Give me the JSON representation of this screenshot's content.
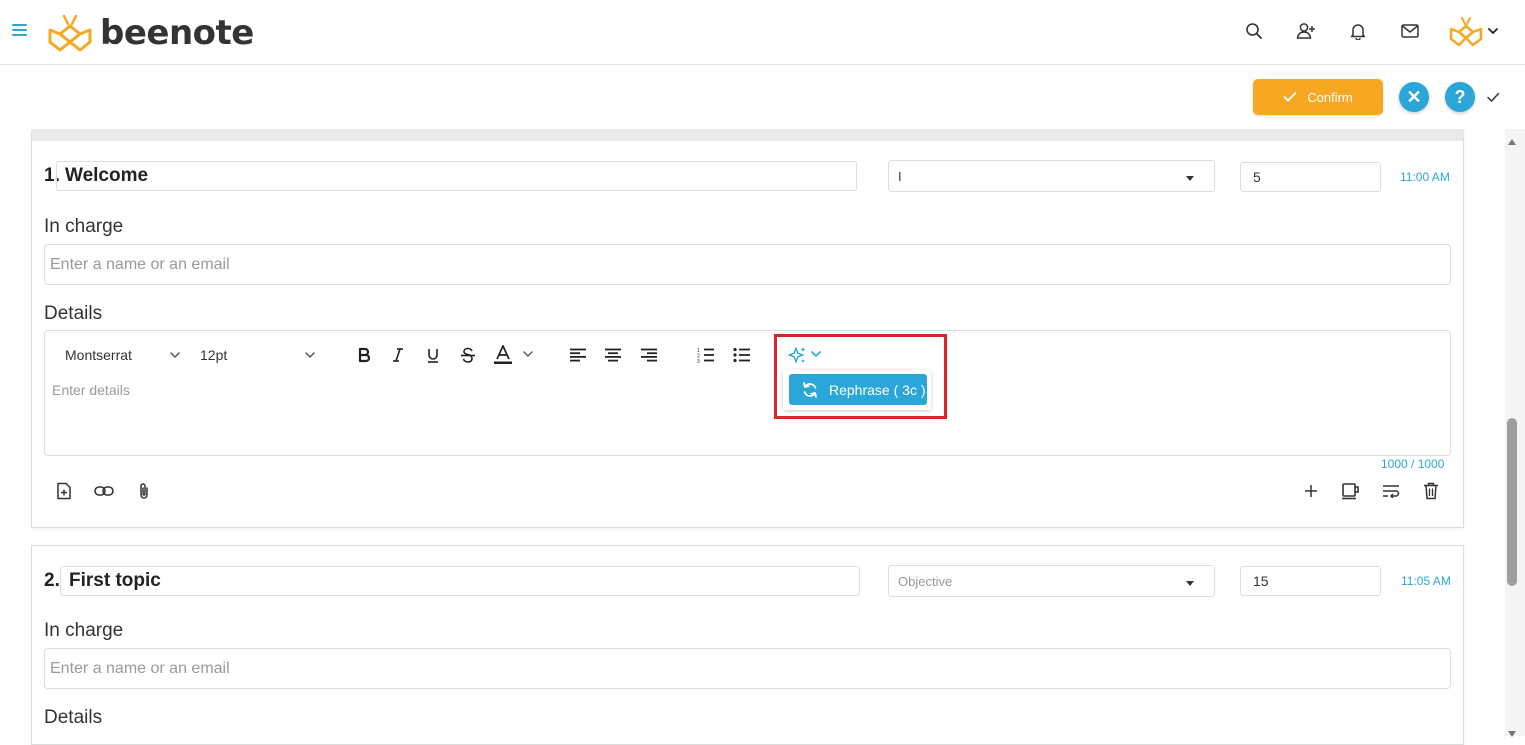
{
  "app": {
    "logo_text": "beenote"
  },
  "header": {
    "icons": [
      "search-icon",
      "add-user-icon",
      "bell-icon",
      "mail-icon",
      "avatar",
      "chevron-down-icon"
    ]
  },
  "actions": {
    "confirm_label": "Confirm",
    "close_symbol": "✕",
    "help_symbol": "?"
  },
  "topics": [
    {
      "number": "1.",
      "title": "Welcome",
      "type_value": "I",
      "duration": "5",
      "time": "11:00 AM",
      "in_charge_label": "In charge",
      "in_charge_placeholder": "Enter a name or an email",
      "details_label": "Details",
      "details_placeholder": "Enter details",
      "char_counter": "1000 / 1000"
    },
    {
      "number": "2.",
      "title": "First topic",
      "type_value": "Objective",
      "duration": "15",
      "time": "11:05 AM",
      "in_charge_label": "In charge",
      "in_charge_placeholder": "Enter a name or an email",
      "details_label": "Details"
    }
  ],
  "editor_toolbar": {
    "font_family": "Montserrat",
    "font_size": "12pt",
    "ai_menu": {
      "rephrase_label": "Rephrase ( 3c )"
    }
  },
  "colors": {
    "accent": "#2aa7d8",
    "confirm": "#f7a823",
    "highlight": "#d9262c"
  }
}
